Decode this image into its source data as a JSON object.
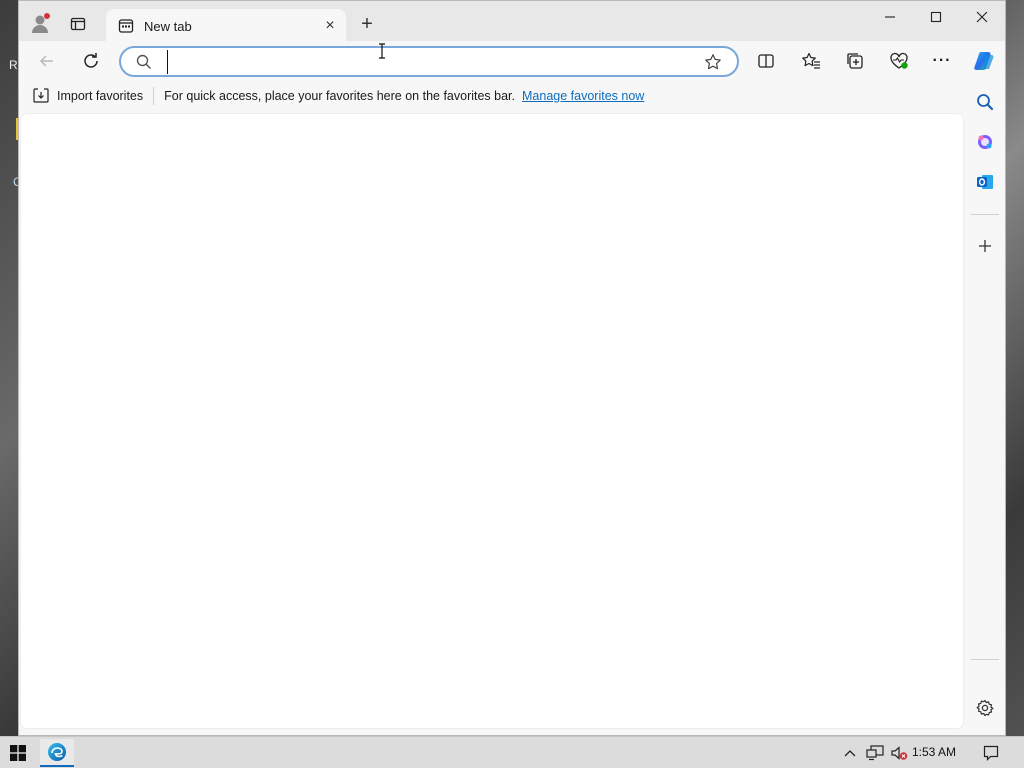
{
  "browser": {
    "tab_title": "New tab",
    "tab_close_glyph": "×",
    "new_tab_glyph": "+",
    "window_controls": {
      "minimize": "—",
      "maximize": "☐",
      "close": "✕"
    }
  },
  "toolbar": {
    "address_value": "",
    "address_placeholder": "",
    "more_glyph": "···"
  },
  "favorites_bar": {
    "import_label": "Import favorites",
    "hint_text": "For quick access, place your favorites here on the favorites bar.",
    "manage_link": "Manage favorites now"
  },
  "sidebar": {
    "items": [
      "search-icon",
      "copilot-apps-icon",
      "outlook-icon",
      "add-icon",
      "settings-icon"
    ]
  },
  "taskbar": {
    "time": "1:53 AM"
  },
  "desktop": {
    "edge_text_1": "R",
    "edge_text_2": "C"
  },
  "colors": {
    "accent": "#0f6cbd",
    "address_border": "#7aa7d9"
  }
}
